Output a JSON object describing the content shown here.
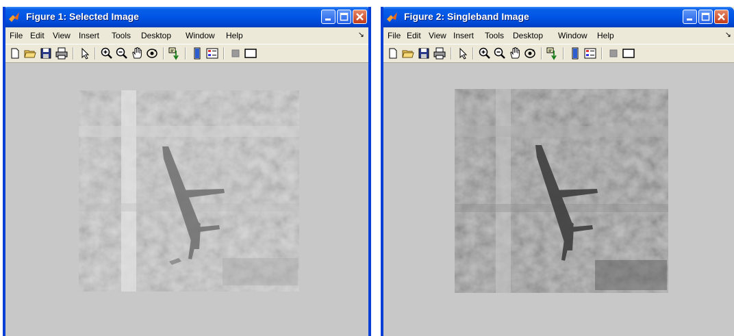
{
  "figure1": {
    "title": "Figure 1: Selected Image",
    "menu": [
      "File",
      "Edit",
      "View",
      "Insert",
      "Tools",
      "Desktop",
      "Window",
      "Help"
    ],
    "menu_overflow": "↘"
  },
  "figure2": {
    "title": "Figure 2: Singleband Image",
    "menu": [
      "File",
      "Edit",
      "View",
      "Insert",
      "Tools",
      "Desktop",
      "Window",
      "Help"
    ],
    "menu_overflow": "↘"
  },
  "toolbar_icons": [
    "new-figure-icon",
    "open-file-icon",
    "save-figure-icon",
    "print-figure-icon",
    "edit-plot-icon",
    "zoom-in-icon",
    "zoom-out-icon",
    "pan-icon",
    "rotate-3d-icon",
    "data-cursor-icon",
    "insert-colorbar-icon",
    "insert-legend-icon",
    "hide-plot-tools-icon",
    "show-plot-tools-icon"
  ],
  "colors": {
    "titlebar": "#0055E5",
    "window_bg": "#ECE9D8",
    "canvas_bg": "#C8C8C8",
    "image1_tone": "#C9C9C9",
    "image2_tone": "#9E9E9E"
  }
}
